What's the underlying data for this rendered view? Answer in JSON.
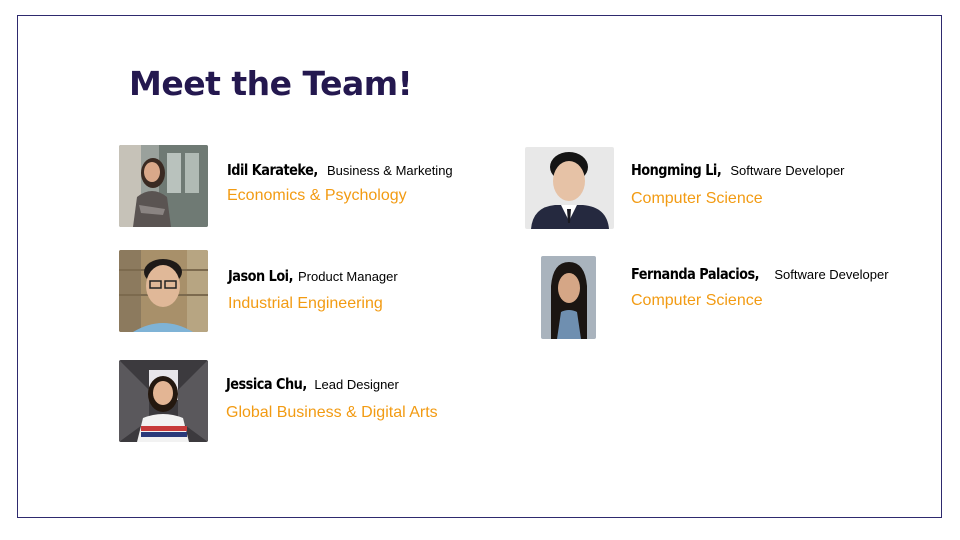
{
  "slide": {
    "title": "Meet the Team!",
    "accent_color": "#f29b13",
    "title_color": "#24184f",
    "members": [
      {
        "name": "Idil Karateke,",
        "role": "Business & Marketing",
        "major": "Economics & Psychology"
      },
      {
        "name": "Jason Loi,",
        "role": "Product Manager",
        "major": "Industrial Engineering"
      },
      {
        "name": "Jessica Chu,",
        "role": "Lead Designer",
        "major": "Global Business & Digital Arts"
      },
      {
        "name": "Hongming Li,",
        "role": "Software Developer",
        "major": "Computer Science"
      },
      {
        "name": "Fernanda Palacios,",
        "role": "Software Developer",
        "major": "Computer Science"
      }
    ]
  }
}
